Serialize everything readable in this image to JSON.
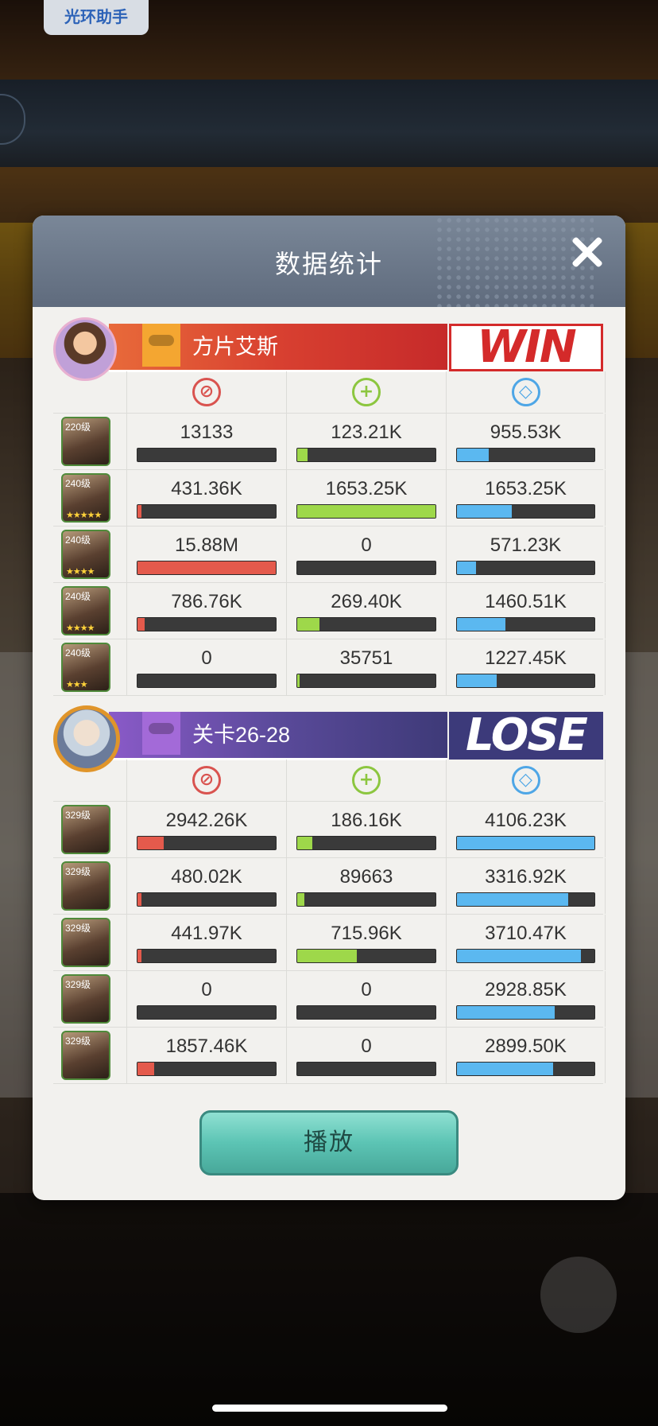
{
  "app": {
    "helper_label": "光环助手"
  },
  "dialog": {
    "title": "数据统计",
    "play_label": "播放"
  },
  "teams": [
    {
      "name": "方片艾斯",
      "result": "WIN",
      "rows": [
        {
          "level": "220级",
          "stars": "",
          "dmg": "13133",
          "dmg_pct": 0.0,
          "heal": "123.21K",
          "heal_pct": 0.075,
          "def": "955.53K",
          "def_pct": 0.23
        },
        {
          "level": "240级",
          "stars": "★★★★★",
          "dmg": "431.36K",
          "dmg_pct": 0.03,
          "heal": "1653.25K",
          "heal_pct": 1.0,
          "def": "1653.25K",
          "def_pct": 0.4
        },
        {
          "level": "240级",
          "stars": "★★★★",
          "dmg": "15.88M",
          "dmg_pct": 1.0,
          "heal": "0",
          "heal_pct": 0,
          "def": "571.23K",
          "def_pct": 0.14
        },
        {
          "level": "240级",
          "stars": "★★★★",
          "dmg": "786.76K",
          "dmg_pct": 0.05,
          "heal": "269.40K",
          "heal_pct": 0.16,
          "def": "1460.51K",
          "def_pct": 0.35
        },
        {
          "level": "240级",
          "stars": "★★★",
          "dmg": "0",
          "dmg_pct": 0,
          "heal": "35751",
          "heal_pct": 0.02,
          "def": "1227.45K",
          "def_pct": 0.29
        }
      ]
    },
    {
      "name": "关卡26-28",
      "result": "LOSE",
      "rows": [
        {
          "level": "329级",
          "stars": "",
          "dmg": "2942.26K",
          "dmg_pct": 0.19,
          "heal": "186.16K",
          "heal_pct": 0.11,
          "def": "4106.23K",
          "def_pct": 1.0
        },
        {
          "level": "329级",
          "stars": "",
          "dmg": "480.02K",
          "dmg_pct": 0.03,
          "heal": "89663",
          "heal_pct": 0.05,
          "def": "3316.92K",
          "def_pct": 0.81
        },
        {
          "level": "329级",
          "stars": "",
          "dmg": "441.97K",
          "dmg_pct": 0.03,
          "heal": "715.96K",
          "heal_pct": 0.43,
          "def": "3710.47K",
          "def_pct": 0.9
        },
        {
          "level": "329级",
          "stars": "",
          "dmg": "0",
          "dmg_pct": 0,
          "heal": "0",
          "heal_pct": 0,
          "def": "2928.85K",
          "def_pct": 0.71
        },
        {
          "level": "329级",
          "stars": "",
          "dmg": "1857.46K",
          "dmg_pct": 0.12,
          "heal": "0",
          "heal_pct": 0,
          "def": "2899.50K",
          "def_pct": 0.7
        }
      ]
    }
  ],
  "colors": {
    "damage": "#e45a4c",
    "heal": "#9ed84a",
    "defense": "#5bb8f0",
    "win": "#d42a2a",
    "lose": "#3c3a7a"
  }
}
